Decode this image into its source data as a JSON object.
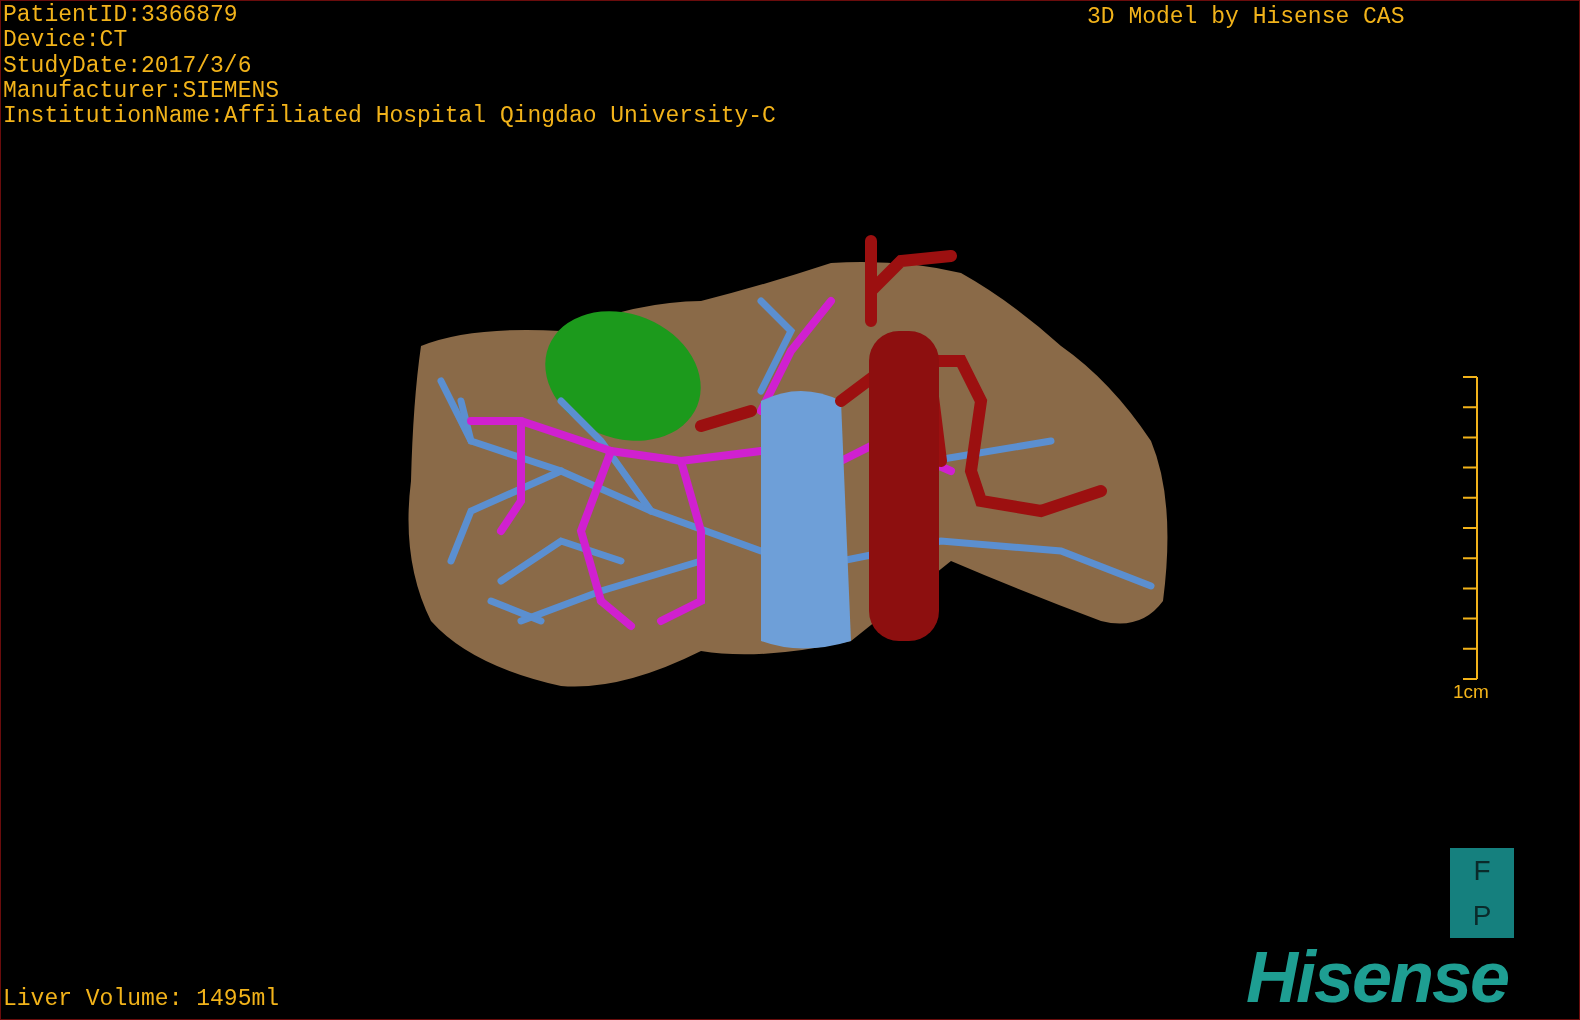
{
  "patient_info": [
    "PatientID:3366879",
    "Device:CT",
    "StudyDate:2017/3/6",
    "Manufacturer:SIEMENS",
    "InstitutionName:Affiliated Hospital Qingdao University-C"
  ],
  "title": "3D Model by Hisense CAS",
  "scale_bar": {
    "label": "1cm"
  },
  "orientation_cube": {
    "faces": [
      "F",
      "P"
    ]
  },
  "logo": "Hisense",
  "liver_volume": "Liver Volume: 1495ml"
}
